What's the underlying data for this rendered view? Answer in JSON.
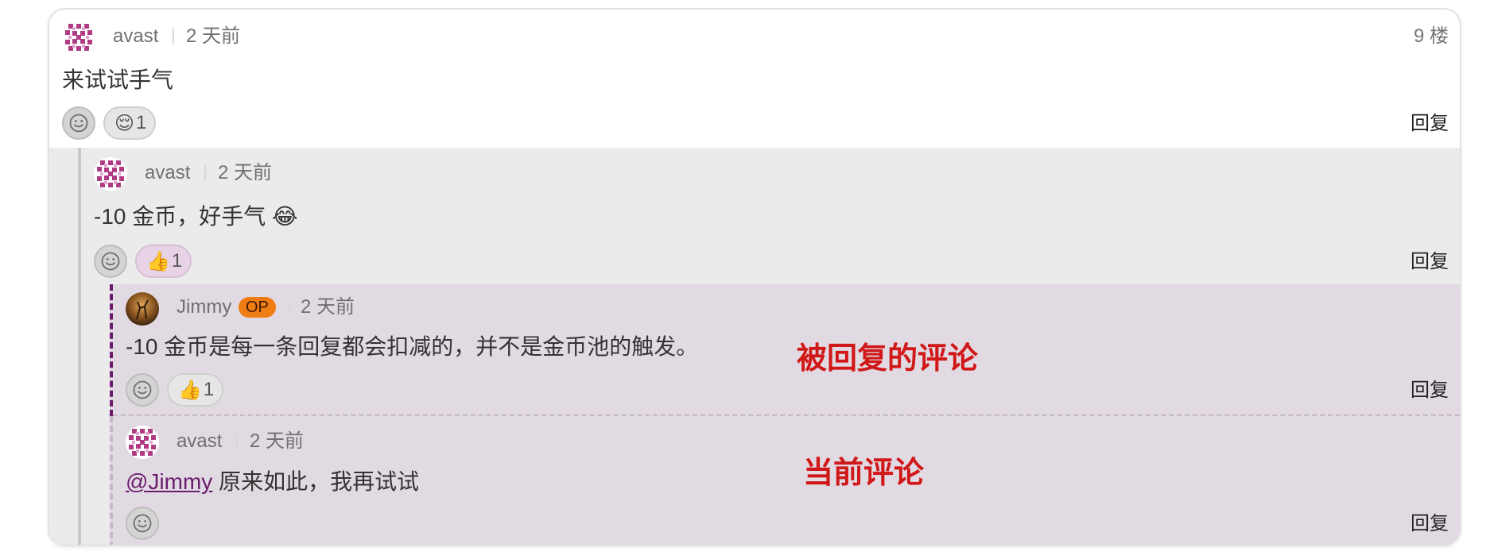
{
  "floor_label": "9 楼",
  "reply_label": "回复",
  "comments": [
    {
      "author": "avast",
      "time": "2 天前",
      "text": "来试试手气",
      "reaction": {
        "emoji": "😌",
        "count": "1"
      }
    },
    {
      "author": "avast",
      "time": "2 天前",
      "text": "-10 金币，好手气 😂",
      "reaction": {
        "emoji": "👍",
        "count": "1"
      }
    },
    {
      "author": "Jimmy",
      "badge": "OP",
      "time": "2 天前",
      "text": "-10 金币是每一条回复都会扣减的，并不是金币池的触发。",
      "reaction": {
        "emoji": "👍",
        "count": "1"
      }
    },
    {
      "author": "avast",
      "time": "2 天前",
      "mention": "@Jimmy",
      "text": " 原来如此，我再试试"
    }
  ],
  "annotations": {
    "replied": "被回复的评论",
    "current": "当前评论"
  },
  "colors": {
    "annotation": "#d01818",
    "op_badge": "#f07c14",
    "mention": "#6a1b6e",
    "nested_bg_1": "#ebebeb",
    "nested_bg_2": "#e2dae2"
  },
  "icons": [
    "avatar-identicon",
    "jimmy-avatar",
    "smiley-icon"
  ]
}
